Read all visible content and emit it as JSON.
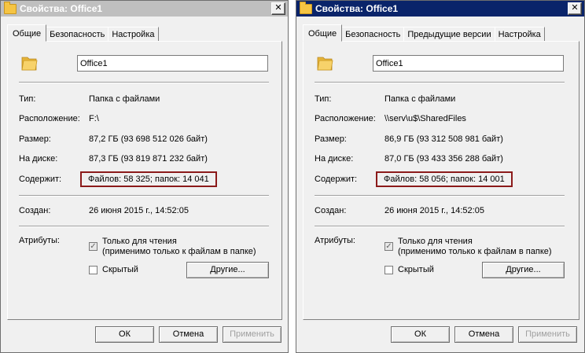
{
  "dialogs": [
    {
      "title": "Свойства: Office1",
      "close_glyph": "✕",
      "tabs": [
        {
          "label": "Общие",
          "active": true
        },
        {
          "label": "Безопасность",
          "active": false
        },
        {
          "label": "Настройка",
          "active": false
        }
      ],
      "name_value": "Office1",
      "type_label": "Тип:",
      "type_value": "Папка с файлами",
      "location_label": "Расположение:",
      "location_value": "F:\\",
      "size_label": "Размер:",
      "size_value": "87,2 ГБ (93 698 512 026 байт)",
      "disk_label": "На диске:",
      "disk_value": "87,3 ГБ (93 819 871 232 байт)",
      "contains_label": "Содержит:",
      "contains_value": "Файлов: 58 325; папок: 14 041",
      "created_label": "Создан:",
      "created_value": "26 июня 2015 г., 14:52:05",
      "attributes_label": "Атрибуты:",
      "readonly_label_1": "Только для чтения",
      "readonly_label_2": "(применимо только к файлам в папке)",
      "readonly_checked": true,
      "hidden_label": "Скрытый",
      "hidden_checked": false,
      "other_button": "Другие...",
      "ok_button": "ОК",
      "cancel_button": "Отмена",
      "apply_button": "Применить"
    },
    {
      "title": "Свойства: Office1",
      "close_glyph": "✕",
      "tabs": [
        {
          "label": "Общие",
          "active": true
        },
        {
          "label": "Безопасность",
          "active": false
        },
        {
          "label": "Предыдущие версии",
          "active": false
        },
        {
          "label": "Настройка",
          "active": false
        }
      ],
      "name_value": "Office1",
      "type_label": "Тип:",
      "type_value": "Папка с файлами",
      "location_label": "Расположение:",
      "location_value": "\\\\serv\\u$\\SharedFiles",
      "size_label": "Размер:",
      "size_value": "86,9 ГБ (93 312 508 981 байт)",
      "disk_label": "На диске:",
      "disk_value": "87,0 ГБ (93 433 356 288 байт)",
      "contains_label": "Содержит:",
      "contains_value": "Файлов: 58 056; папок: 14 001",
      "created_label": "Создан:",
      "created_value": "26 июня 2015 г., 14:52:05",
      "attributes_label": "Атрибуты:",
      "readonly_label_1": "Только для чтения",
      "readonly_label_2": "(применимо только к файлам в папке)",
      "readonly_checked": true,
      "hidden_label": "Скрытый",
      "hidden_checked": false,
      "other_button": "Другие...",
      "ok_button": "ОК",
      "cancel_button": "Отмена",
      "apply_button": "Применить"
    }
  ],
  "colors": {
    "inactive_title": "#bfbfbf",
    "active_title": "#0a246a",
    "highlight_box": "#8b1a1a",
    "folder": "#f5c443"
  }
}
